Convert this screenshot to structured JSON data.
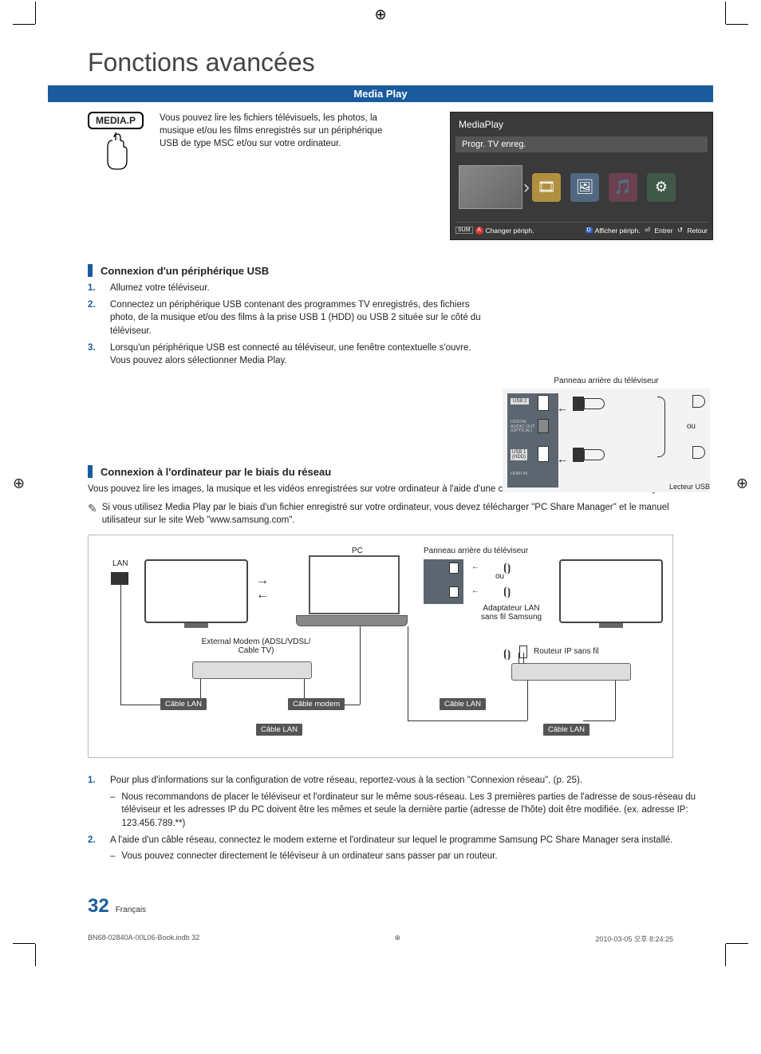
{
  "page_title": "Fonctions avancées",
  "section_bar": "Media Play",
  "mediap_button": "MEDIA.P",
  "mediap_desc": "Vous pouvez lire les fichiers télévisuels, les photos, la musique et/ou les films enregistrés sur un périphérique USB de type MSC et/ou sur votre ordinateur.",
  "tv": {
    "title": "MediaPlay",
    "sub": "Progr. TV enreg.",
    "footer_left_sum": "SUM",
    "footer_left_a": "A",
    "footer_left_change": "Changer périph.",
    "footer_d": "D",
    "footer_afficher": "Afficher périph.",
    "footer_entrer": "Entrer",
    "footer_retour": "Retour"
  },
  "sub1": "Connexion d'un périphérique USB",
  "usb_steps": {
    "s1": "Allumez votre téléviseur.",
    "s2": "Connectez un périphérique USB contenant des programmes TV enregistrés, des fichiers photo, de la musique et/ou des films à la prise USB 1 (HDD) ou USB 2 située sur le côté du téléviseur.",
    "s3": "Lorsqu'un périphérique USB est connecté au téléviseur, une fenêtre contextuelle s'ouvre. Vous pouvez alors sélectionner Media Play."
  },
  "rear_panel_title": "Panneau arrière du téléviseur",
  "rear_panel": {
    "usb2": "USB 2",
    "digital": "DIGITAL\nAUDIO OUT\n(OPTICAL)",
    "usb1": "USB 1\n(HDD)",
    "hdmi": "HDMI IN",
    "ou": "ou",
    "reader": "Lecteur USB"
  },
  "sub2": "Connexion à l'ordinateur par le biais du réseau",
  "net_intro": "Vous pouvez lire les images, la musique et les vidéos enregistrées sur votre ordinateur à l'aide d'une connexion réseau en mode Media Play.",
  "net_note": "Si vous utilisez Media Play par le biais d'un fichier enregistré sur votre ordinateur, vous devez télécharger \"PC Share Manager\" et le manuel utilisateur sur le site Web \"www.samsung.com\".",
  "diagram": {
    "lan": "LAN",
    "pc": "PC",
    "rear": "Panneau arrière du téléviseur",
    "ou": "ou",
    "adapter": "Adaptateur LAN sans fil Samsung",
    "ext_modem": "External Modem (ADSL/VDSL/ Cable TV)",
    "router": "Routeur IP sans fil",
    "cable_lan": "Câble LAN",
    "cable_modem": "Câble modem"
  },
  "net_steps": {
    "s1": "Pour plus d'informations sur la configuration de votre réseau, reportez-vous à la section \"Connexion réseau\". (p. 25).",
    "s1a": "Nous recommandons de placer le téléviseur et l'ordinateur sur le même sous-réseau. Les 3 premières parties de l'adresse de sous-réseau du téléviseur et les adresses IP du PC doivent être les mêmes et seule la dernière partie (adresse de l'hôte) doit être modifiée. (ex. adresse IP: 123.456.789.**)",
    "s2": "A l'aide d'un câble réseau, connectez le modem externe et l'ordinateur sur lequel le programme Samsung PC Share Manager sera installé.",
    "s2a": "Vous pouvez connecter directement le téléviseur à un ordinateur sans passer par un routeur."
  },
  "page_number": "32",
  "page_lang": "Français",
  "footer_left": "BN68-02840A-00L06-Book.indb   32",
  "footer_right": "2010-03-05   오후 8:24:25"
}
